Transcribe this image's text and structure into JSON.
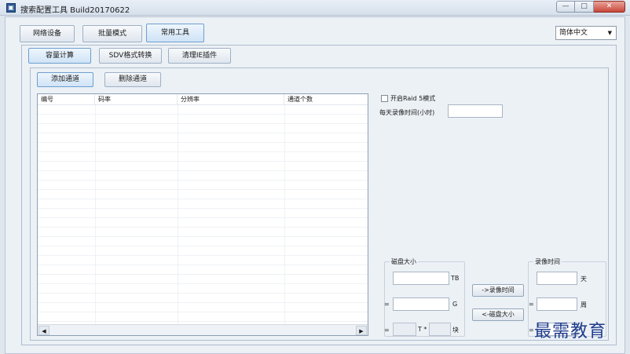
{
  "window": {
    "title": "搜索配置工具 Build20170622",
    "app_icon": "app-icon"
  },
  "controls": {
    "minimize": "—",
    "maximize": "□",
    "close": "✕"
  },
  "top_tabs": [
    "网络设备",
    "批量模式",
    "常用工具"
  ],
  "active_top_tab": "常用工具",
  "language": {
    "selected": "简体中文"
  },
  "sub_tabs": [
    "容量计算",
    "SDV格式转换",
    "清理IE插件"
  ],
  "active_sub_tab": "容量计算",
  "actions": {
    "add_channel": "添加通道",
    "delete_channel": "删除通道"
  },
  "table": {
    "columns": [
      "编号",
      "码率",
      "分辨率",
      "通道个数"
    ]
  },
  "raid": {
    "label": "开启Raid 5模式",
    "checked": false
  },
  "daily_hours": {
    "label": "每天录像时间(小时)",
    "value": ""
  },
  "disk_group": {
    "title": "磁盘大小",
    "unit_tb": "TB",
    "unit_g": "G",
    "eq1": "=",
    "eq2": "=",
    "t_label": "T *",
    "block_label": "块"
  },
  "convert": {
    "to_time": "->录像时间",
    "to_size": "<-磁盘大小"
  },
  "time_group": {
    "title": "录像时间",
    "unit_day": "天",
    "unit_week": "周",
    "eq1": "=",
    "eq2": "="
  },
  "watermark": "最需教育"
}
